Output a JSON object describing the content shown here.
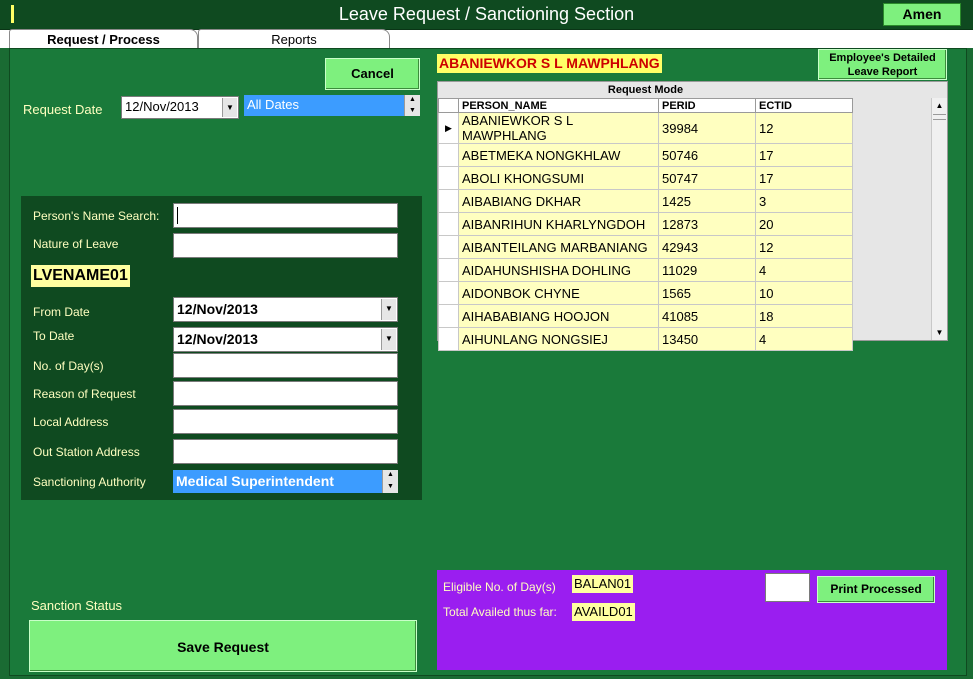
{
  "window": {
    "title": "Leave Request / Sanctioning Section",
    "user_button": "Amen"
  },
  "tabs": [
    {
      "label": "Request / Process",
      "active": true
    },
    {
      "label": "Reports",
      "active": false
    }
  ],
  "toolbar": {
    "cancel_label": "Cancel",
    "request_date_label": "Request Date",
    "request_date_value": "12/Nov/2013",
    "date_filter_value": "All Dates"
  },
  "form": {
    "name_search_label": "Person's Name Search:",
    "name_search_value": "",
    "nature_label": "Nature of Leave",
    "nature_value": "",
    "leave_name_tag": "LVENAME01",
    "from_date_label": "From Date",
    "from_date_value": "12/Nov/2013",
    "to_date_label": "To Date",
    "to_date_value": "12/Nov/2013",
    "days_label": "No. of Day(s)",
    "days_value": "",
    "reason_label": "Reason of Request",
    "reason_value": "",
    "local_address_label": "Local Address",
    "local_address_value": "",
    "out_station_label": "Out Station Address",
    "out_station_value": "",
    "authority_label": "Sanctioning Authority",
    "authority_value": "Medical Superintendent"
  },
  "sanction_status_label": "Sanction Status",
  "save_button_label": "Save Request",
  "employee": {
    "selected_name": "ABANIEWKOR S L MAWPHLANG",
    "report_button": "Employee's Detailed Leave Report"
  },
  "grid": {
    "caption": "Request Mode",
    "columns": [
      "PERSON_NAME",
      "PERID",
      "ECTID"
    ],
    "rows": [
      {
        "name": "ABANIEWKOR S L MAWPHLANG",
        "perid": "39984",
        "ectid": "12"
      },
      {
        "name": "ABETMEKA NONGKHLAW",
        "perid": "50746",
        "ectid": "17"
      },
      {
        "name": "ABOLI KHONGSUMI",
        "perid": "50747",
        "ectid": "17"
      },
      {
        "name": "AIBABIANG DKHAR",
        "perid": "1425",
        "ectid": "3"
      },
      {
        "name": "AIBANRIHUN KHARLYNGDOH",
        "perid": "12873",
        "ectid": "20"
      },
      {
        "name": "AIBANTEILANG MARBANIANG",
        "perid": "42943",
        "ectid": "12"
      },
      {
        "name": "AIDAHUNSHISHA DOHLING",
        "perid": "11029",
        "ectid": "4"
      },
      {
        "name": "AIDONBOK CHYNE",
        "perid": "1565",
        "ectid": "10"
      },
      {
        "name": "AIHABABIANG HOOJON",
        "perid": "41085",
        "ectid": "18"
      },
      {
        "name": "AIHUNLANG NONGSIEJ",
        "perid": "13450",
        "ectid": "4"
      }
    ]
  },
  "summary": {
    "eligible_label": "Eligible No. of Day(s)",
    "eligible_value": "BALAN01",
    "availed_label": "Total Availed thus far:",
    "availed_value": "AVAILD01",
    "print_button": "Print Processed",
    "small_box_value": ""
  },
  "colors": {
    "background": "#1a7a3a",
    "titlebar": "#0f4a20",
    "button_green": "#7ef07e",
    "highlight_yellow": "#ffff66",
    "label_yellow": "#ffffc0",
    "selection_blue": "#3c9cff",
    "summary_purple": "#9a1ef0",
    "name_red": "#cc0000"
  }
}
